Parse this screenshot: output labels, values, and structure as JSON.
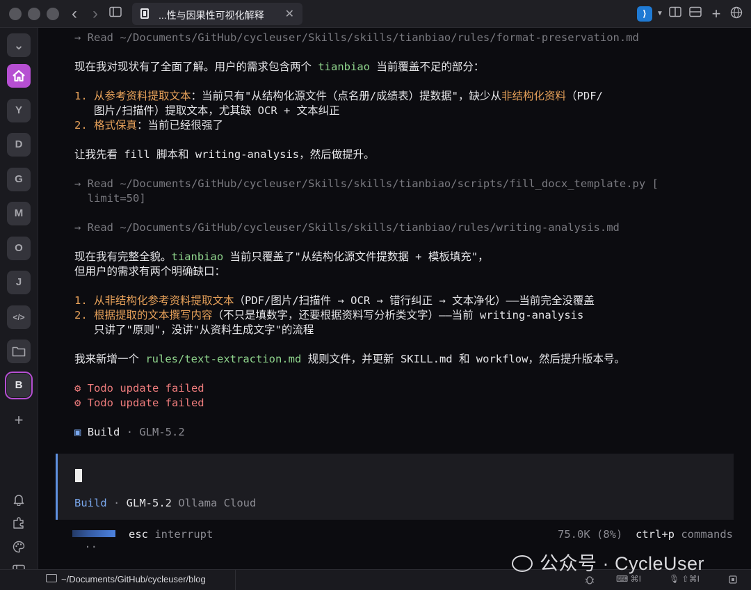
{
  "window": {
    "tab_title": "...性与因果性可视化解释",
    "tab_close": "✕"
  },
  "titlebar": {
    "back_glyph": "‹",
    "forward_glyph": "›",
    "vscode_glyph": "⟩"
  },
  "rail": {
    "top_toggle": "⌄",
    "workspaces": [
      "Y",
      "D",
      "G",
      "M",
      "O",
      "J"
    ],
    "code_glyph": "</>",
    "active_workspace": "B",
    "add_glyph": "+"
  },
  "terminal": {
    "lines": {
      "read1": "→ Read ~/Documents/GitHub/cycleuser/Skills/skills/tianbiao/rules/format-preservation.md",
      "intro_a": "现在我对现状有了全面了解。用户的需求包含两个 ",
      "intro_hl": "tianbiao",
      "intro_b": " 当前覆盖不足的部分：",
      "item1_num": "1. ",
      "item1_hl": "从参考资料提取文本",
      "item1_a": "：当前只有\"从结构化源文件（点名册/成绩表）提数据\"，缺少从",
      "item1_hl2": "非结构化资料",
      "item1_b": "（PDF/",
      "item1_cont": "   图片/扫描件）提取文本，尤其缺 OCR + 文本纠正",
      "item2_num": "2. ",
      "item2_hl": "格式保真",
      "item2_a": "：当前已经很强了",
      "letme": "让我先看 fill 脚本和 writing-analysis，然后做提升。",
      "read2a": "→ Read ~/Documents/GitHub/cycleuser/Skills/skills/tianbiao/scripts/fill_docx_template.py [",
      "read2b": "  limit=50]",
      "read3": "→ Read ~/Documents/GitHub/cycleuser/Skills/skills/tianbiao/rules/writing-analysis.md",
      "now_a": "现在我有完整全貌。",
      "now_hl": "tianbiao",
      "now_b": " 当前只覆盖了\"从结构化源文件提数据 + 模板填充\"，",
      "now_c": "但用户的需求有两个明确缺口：",
      "gap1_num": "1. ",
      "gap1_hl": "从非结构化参考资料提取文本",
      "gap1_a": "（PDF/图片/扫描件 → OCR → 错行纠正 → 文本净化）——当前完全没覆盖",
      "gap2_num": "2. ",
      "gap2_hl": "根据提取的文本撰写内容",
      "gap2_a": "（不只是填数字，还要根据资料写分析类文字）——当前 writing-analysis",
      "gap2_cont": "   只讲了\"原则\"，没讲\"从资料生成文字\"的流程",
      "plan_a": "我来新增一个 ",
      "plan_hl": "rules/text-extraction.md",
      "plan_b": " 规则文件，并更新 SKILL.md 和 workflow，然后提升版本号。",
      "todo1": "⚙ Todo update failed",
      "todo2": "⚙ Todo update failed",
      "build_icon": "▣",
      "build_label": "Build",
      "build_sep": " · ",
      "build_model": "GLM-5.2"
    },
    "input": {
      "mode": "Build",
      "sep": " · ",
      "model": "GLM-5.2",
      "provider": "Ollama Cloud"
    },
    "status": {
      "dots": "··",
      "esc_key": "esc",
      "esc_label": "interrupt",
      "tokens": "75.0K (8%)",
      "cmd_key": "ctrl+p",
      "cmd_label": "commands"
    }
  },
  "bottombar": {
    "path": "~/Documents/GitHub/cycleuser/blog",
    "kbd_shortcut": "⌘I",
    "mic_shortcut": "⇧⌘I"
  },
  "watermark": {
    "text": "公众号 · CycleUser"
  }
}
